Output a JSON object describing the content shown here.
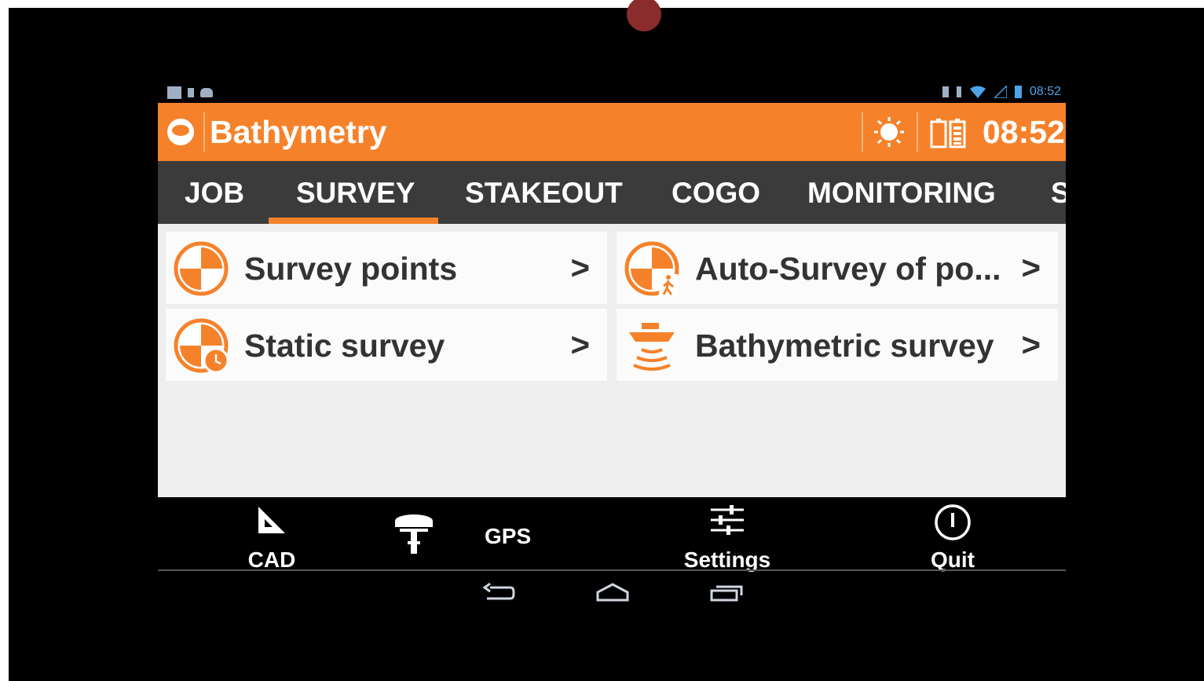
{
  "status_bar": {
    "time": "08:52"
  },
  "action_bar": {
    "title": "Bathymetry",
    "clock": "08:52"
  },
  "tabs": [
    {
      "label": "JOB"
    },
    {
      "label": "SURVEY",
      "active": true
    },
    {
      "label": "STAKEOUT"
    },
    {
      "label": "COGO"
    },
    {
      "label": "MONITORING"
    },
    {
      "label": "S"
    }
  ],
  "menu": [
    {
      "label": "Survey points",
      "icon": "survey-target-icon"
    },
    {
      "label": "Auto-Survey of po...",
      "icon": "auto-survey-walker-icon"
    },
    {
      "label": "Static survey",
      "icon": "static-survey-clock-icon"
    },
    {
      "label": "Bathymetric survey",
      "icon": "boat-sonar-icon"
    }
  ],
  "arrow_glyph": ">",
  "bottom_bar": {
    "cad": "CAD",
    "gps": "GPS",
    "settings": "Settings",
    "quit": "Quit"
  },
  "colors": {
    "accent": "#f5822a",
    "tab_bg": "#3b3b3b",
    "content_bg": "#eeeeee"
  }
}
